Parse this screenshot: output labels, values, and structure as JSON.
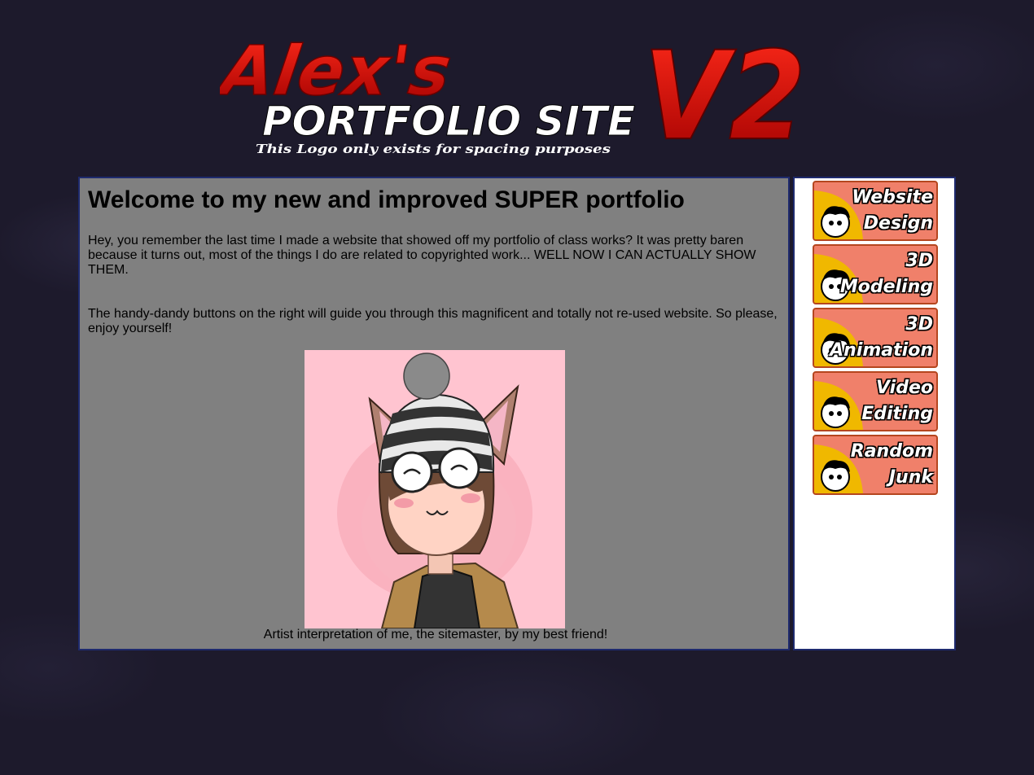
{
  "logo": {
    "line1": "Alex's",
    "line2": "PORTFOLIO SITE",
    "version": "V2",
    "tagline": "This Logo only exists for spacing purposes"
  },
  "main": {
    "title": "Welcome to my new and improved SUPER portfolio",
    "paragraph1": "Hey, you remember the last time I made a website that showed off my portfolio of class works? It was pretty baren because it turns out, most of the things I do are related to copyrighted work... WELL NOW I CAN ACTUALLY SHOW THEM.",
    "paragraph2": "The handy-dandy buttons on the right will guide you through this magnificent and totally not re-used website. So please, enjoy yourself!",
    "caption": "Artist interpretation of me, the sitemaster, by my best friend!"
  },
  "nav": {
    "items": [
      {
        "label": "Website\nDesign"
      },
      {
        "label": "3D\nModeling"
      },
      {
        "label": "3D\nAnimation"
      },
      {
        "label": "Video\nEditing"
      },
      {
        "label": "Random\nJunk"
      }
    ]
  },
  "colors": {
    "background": "#1d1a2c",
    "panel_border": "#1e2a6e",
    "main_panel": "#808080",
    "logo_red": "#e01010",
    "button_fill": "#f0806a",
    "button_corner": "#f0b800"
  },
  "icons": {
    "nav_button_avatar": "cartoon-face-icon"
  }
}
